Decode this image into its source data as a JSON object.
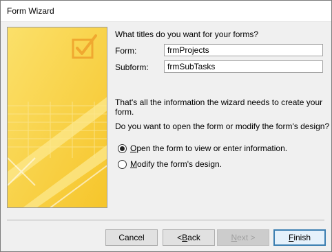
{
  "window": {
    "title": "Form Wizard"
  },
  "prompt": {
    "titles_question": "What titles do you want for your forms?"
  },
  "fields": {
    "form_label": "Form:",
    "form_value": "frmProjects",
    "subform_label": "Subform:",
    "subform_value": "frmSubTasks"
  },
  "info": {
    "line1": "That's all the information the wizard needs to create your",
    "line2": "form.",
    "question": "Do you want to open the form or modify the form's design?"
  },
  "options": {
    "open": {
      "mnemonic": "O",
      "rest": "pen the form to view or enter information.",
      "checked": true
    },
    "modify": {
      "mnemonic": "M",
      "rest": "odify the form's design.",
      "checked": false
    }
  },
  "buttons": {
    "cancel": "Cancel",
    "back_prefix": "< ",
    "back_mnemonic": "B",
    "back_rest": "ack",
    "next_mnemonic": "N",
    "next_rest": "ext >",
    "finish_mnemonic": "F",
    "finish_rest": "inish"
  },
  "colors": {
    "art_yellow": "#f9d33a",
    "art_light": "#fbe27a",
    "checkmark": "#f0a830",
    "default_button_border": "#3c7fb1"
  }
}
